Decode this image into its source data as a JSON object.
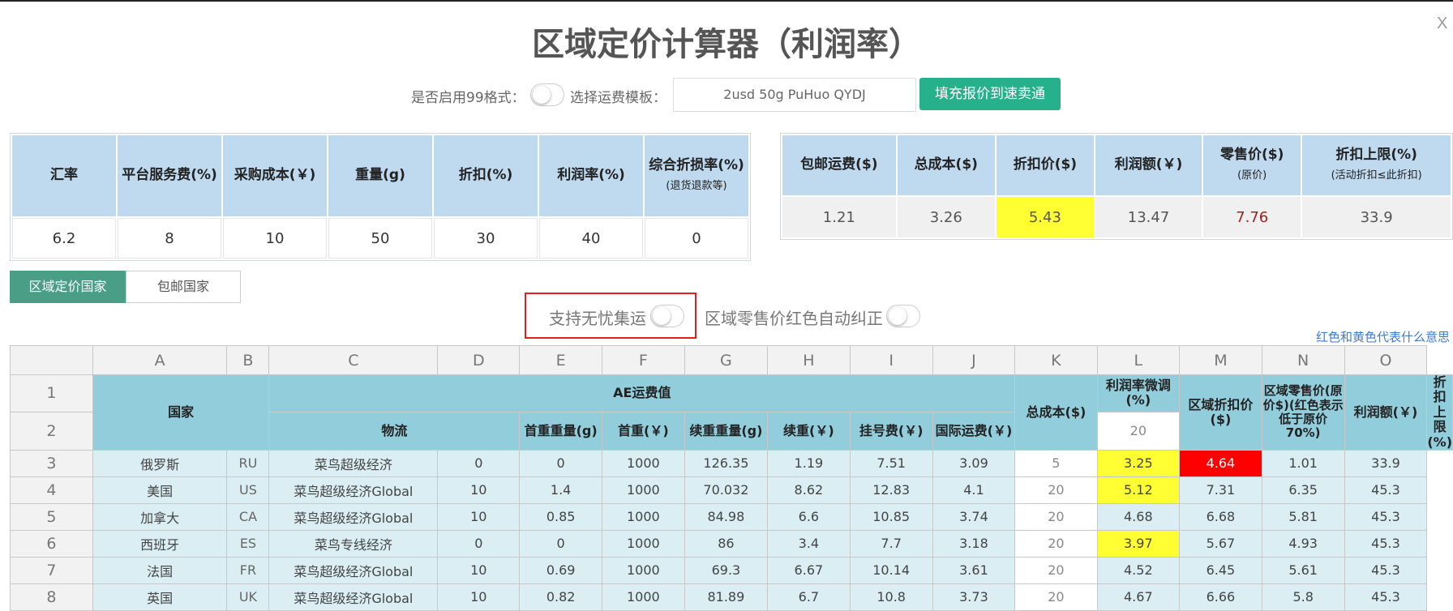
{
  "title": "区域定价计算器（利润率）",
  "close_label": "X",
  "controls": {
    "enable99_label": "是否启用99格式：",
    "template_label": "选择运费模板：",
    "template_value": "2usd 50g PuHuo QYDJ",
    "fill_button": "填充报价到速卖通"
  },
  "inputs": {
    "headers": [
      {
        "main": "汇率",
        "sub": ""
      },
      {
        "main": "平台服务费(%)",
        "sub": ""
      },
      {
        "main": "采购成本(￥)",
        "sub": ""
      },
      {
        "main": "重量(g)",
        "sub": ""
      },
      {
        "main": "折扣(%)",
        "sub": ""
      },
      {
        "main": "利润率(%)",
        "sub": ""
      },
      {
        "main": "综合折损率(%)",
        "sub": "(退货退款等)"
      }
    ],
    "values": [
      "6.2",
      "8",
      "10",
      "50",
      "30",
      "40",
      "0"
    ]
  },
  "results": {
    "headers": [
      {
        "main": "包邮运费($)",
        "sub": ""
      },
      {
        "main": "总成本($)",
        "sub": ""
      },
      {
        "main": "折扣价($)",
        "sub": ""
      },
      {
        "main": "利润额(￥)",
        "sub": ""
      },
      {
        "main": "零售价($)",
        "sub": "(原价)"
      },
      {
        "main": "折扣上限(%)",
        "sub": "(活动折扣≤此折扣)"
      }
    ],
    "values": [
      "1.21",
      "3.26",
      "5.43",
      "13.47",
      "7.76",
      "33.9"
    ]
  },
  "region": {
    "tab_label": "区域定价国家",
    "input_value": "包邮国家"
  },
  "options": {
    "worry_free_label": "支持无忧集运",
    "auto_correct_label": "区域零售价红色自动纠正",
    "hint_link": "红色和黄色代表什么意思"
  },
  "sheet": {
    "col_letters": [
      "A",
      "B",
      "C",
      "D",
      "E",
      "F",
      "G",
      "H",
      "I",
      "J",
      "K",
      "L",
      "M",
      "N",
      "O"
    ],
    "header": {
      "country": "国家",
      "ae_fee": "AE运费值",
      "logistics": "物流",
      "first_weight": "首重重量(g)",
      "first_price": "首重(￥)",
      "cont_weight": "续重重量(g)",
      "cont_price": "续重(￥)",
      "reg_fee": "挂号费(￥)",
      "intl_fee": "国际运费(￥)",
      "total_cost": "总成本($)",
      "margin_adjust": "利润率微调(%)",
      "margin_adjust_default": "20",
      "region_discount": "区域折扣价($)",
      "region_retail": "区域零售价(原价$)(红色表示低于原价70%)",
      "profit": "利润额(￥)",
      "discount_limit": "折扣上限(%)"
    },
    "rows": [
      {
        "n": "3",
        "country": "俄罗斯",
        "code": "RU",
        "logistics": "菜鸟超级经济",
        "fw": "0",
        "fp": "0",
        "cw": "1000",
        "cp": "126.35",
        "reg": "1.19",
        "intl": "7.51",
        "cost": "3.09",
        "adj": "5",
        "disc": "3.25",
        "retail": "4.64",
        "profit": "1.01",
        "limit": "33.9"
      },
      {
        "n": "4",
        "country": "美国",
        "code": "US",
        "logistics": "菜鸟超级经济Global",
        "fw": "10",
        "fp": "1.4",
        "cw": "1000",
        "cp": "70.032",
        "reg": "8.62",
        "intl": "12.83",
        "cost": "4.1",
        "adj": "20",
        "disc": "5.12",
        "retail": "7.31",
        "profit": "6.35",
        "limit": "45.3"
      },
      {
        "n": "5",
        "country": "加拿大",
        "code": "CA",
        "logistics": "菜鸟超级经济Global",
        "fw": "10",
        "fp": "0.85",
        "cw": "1000",
        "cp": "84.98",
        "reg": "6.6",
        "intl": "10.85",
        "cost": "3.74",
        "adj": "20",
        "disc": "4.68",
        "retail": "6.68",
        "profit": "5.81",
        "limit": "45.3"
      },
      {
        "n": "6",
        "country": "西班牙",
        "code": "ES",
        "logistics": "菜鸟专线经济",
        "fw": "0",
        "fp": "0",
        "cw": "1000",
        "cp": "86",
        "reg": "3.4",
        "intl": "7.7",
        "cost": "3.18",
        "adj": "20",
        "disc": "3.97",
        "retail": "5.67",
        "profit": "4.93",
        "limit": "45.3"
      },
      {
        "n": "7",
        "country": "法国",
        "code": "FR",
        "logistics": "菜鸟超级经济Global",
        "fw": "10",
        "fp": "0.69",
        "cw": "1000",
        "cp": "69.3",
        "reg": "6.67",
        "intl": "10.14",
        "cost": "3.61",
        "adj": "20",
        "disc": "4.52",
        "retail": "6.45",
        "profit": "5.61",
        "limit": "45.3"
      },
      {
        "n": "8",
        "country": "英国",
        "code": "UK",
        "logistics": "菜鸟超级经济Global",
        "fw": "10",
        "fp": "0.82",
        "cw": "1000",
        "cp": "81.89",
        "reg": "6.7",
        "intl": "10.8",
        "cost": "3.73",
        "adj": "20",
        "disc": "4.67",
        "retail": "6.66",
        "profit": "5.8",
        "limit": "45.3"
      }
    ]
  },
  "colors": {
    "accent_green": "#26b08c",
    "tab_green": "#4a9e85",
    "header_blue": "#bfd9ef",
    "sheet_header": "#92cddc",
    "sheet_data": "#daeef3",
    "highlight_yellow": "#ffff33",
    "highlight_red": "#ff0000",
    "hint_blue": "#3a7bd5"
  }
}
